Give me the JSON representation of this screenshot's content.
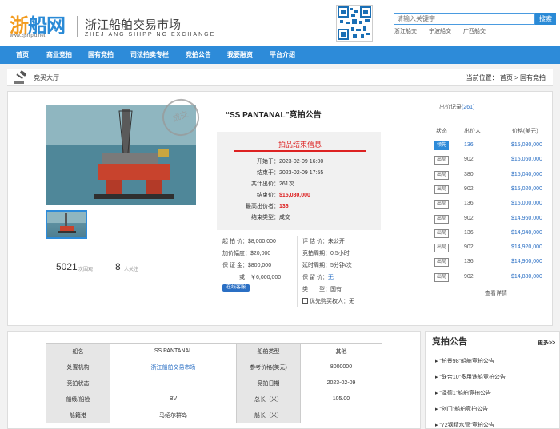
{
  "header": {
    "logo_text_a": "浙",
    "logo_text_b": "船网",
    "logo_url": "www.zjshipid.net",
    "site_name": "浙江船舶交易市场",
    "site_name_en": "ZHEJIANG SHIPPING EXCHANGE",
    "search_placeholder": "请输入关键字",
    "search_button": "搜索",
    "quick_links": [
      "浙江船交",
      "宁波船交",
      "广西船交"
    ]
  },
  "nav": [
    "首页",
    "商业竞拍",
    "国有竞拍",
    "司法拍卖专栏",
    "竞拍公告",
    "我要融资",
    "平台介绍"
  ],
  "breadcrumb": {
    "title": "竞买大厅",
    "prefix": "当前位置：",
    "home": "首页",
    "sep": ">",
    "current": "国有竞拍"
  },
  "auction": {
    "title": "“SS PANTANAL”竞拍公告",
    "stamp": "成交",
    "views": "5021",
    "views_label": "次围观",
    "follows": "8",
    "follows_label": "人关注",
    "end_title": "拍品结束信息",
    "end_info": [
      {
        "k": "开始于：",
        "v": "2023-02-09 16:00"
      },
      {
        "k": "结束于：",
        "v": "2023-02-09 17:55"
      },
      {
        "k": "共计出价：",
        "v": "261次"
      },
      {
        "k": "结束价：",
        "v": "$15,080,000"
      },
      {
        "k": "最高出价者：",
        "v": "136"
      },
      {
        "k": "结束类型：",
        "v": "成交"
      }
    ],
    "left_info": [
      "起 拍 价：$8,000,000",
      "加价幅度：$20,000",
      "保 证 金：$800,000",
      "或　￥6,000,000"
    ],
    "right_info": [
      "评 估 价：未公开",
      "竞拍周期：0.5小时",
      "延时周期：5分钟/次"
    ],
    "reserve_label": "保 留 价：",
    "reserve_value": "无",
    "type_info": "类　　型：国有",
    "priority_info": "优先购买权人：无",
    "qq_label": "在线客服"
  },
  "bids": {
    "title": "出价记录",
    "count": "(261)",
    "headers": [
      "状态",
      "出价人",
      "价格(美元)"
    ],
    "rows": [
      {
        "status": "领先",
        "bidder": "136",
        "price": "$15,080,000"
      },
      {
        "status": "出局",
        "bidder": "902",
        "price": "$15,060,000"
      },
      {
        "status": "出局",
        "bidder": "380",
        "price": "$15,040,000"
      },
      {
        "status": "出局",
        "bidder": "902",
        "price": "$15,020,000"
      },
      {
        "status": "出局",
        "bidder": "136",
        "price": "$15,000,000"
      },
      {
        "status": "出局",
        "bidder": "902",
        "price": "$14,960,000"
      },
      {
        "status": "出局",
        "bidder": "136",
        "price": "$14,940,000"
      },
      {
        "status": "出局",
        "bidder": "902",
        "price": "$14,920,000"
      },
      {
        "status": "出局",
        "bidder": "136",
        "price": "$14,900,000"
      },
      {
        "status": "出局",
        "bidder": "902",
        "price": "$14,880,000"
      }
    ],
    "more": "查看详情"
  },
  "spec": [
    [
      "船名",
      "SS PANTANAL",
      "船舶类型",
      "其他"
    ],
    [
      "处置机构",
      "浙江船舶交易市场",
      "参考价格(美元)",
      "8000000"
    ],
    [
      "竞拍状态",
      "",
      "竞拍日期",
      "2023-02-09"
    ],
    [
      "船级/船检",
      "BV",
      "总长（米）",
      "105.00"
    ],
    [
      "船籍港",
      "马绍尔群岛",
      "船长（米）",
      ""
    ]
  ],
  "notices": {
    "title": "竞拍公告",
    "more": "更多>>",
    "items": [
      "“柏景98”船舶竞拍公告",
      "“联合10”多用途船竞拍公告",
      "“泽德1”船舶竞拍公告",
      "“创门”船舶竞拍公告",
      "“72钢精水管”竞拍公告"
    ]
  },
  "colors": {
    "brand": "#2d8bd9",
    "accent_red": "#d22222"
  }
}
